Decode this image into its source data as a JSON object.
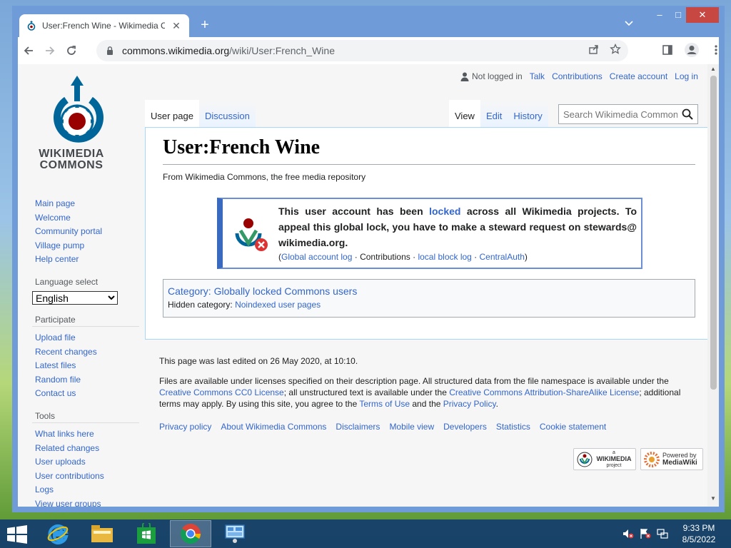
{
  "browser": {
    "tab_title": "User:French Wine - Wikimedia Commons",
    "tab_close": "✕",
    "new_tab": "+",
    "url_domain": "commons.wikimedia.org",
    "url_path": "/wiki/User:French_Wine",
    "window_controls": {
      "minimize": "–",
      "maximize": "□",
      "close": "✕"
    }
  },
  "personal": {
    "not_logged_in": "Not logged in",
    "links": [
      "Talk",
      "Contributions",
      "Create account",
      "Log in"
    ]
  },
  "logo": {
    "line1": "WIKIMEDIA",
    "line2": "COMMONS"
  },
  "sidebar": {
    "main": [
      "Main page",
      "Welcome",
      "Community portal",
      "Village pump",
      "Help center"
    ],
    "language_heading": "Language select",
    "language_value": "English",
    "participate_heading": "Participate",
    "participate": [
      "Upload file",
      "Recent changes",
      "Latest files",
      "Random file",
      "Contact us"
    ],
    "tools_heading": "Tools",
    "tools": [
      "What links here",
      "Related changes",
      "User uploads",
      "User contributions",
      "Logs",
      "View user groups"
    ]
  },
  "tabs": {
    "left": [
      "User page",
      "Discussion"
    ],
    "right": [
      "View",
      "Edit",
      "History"
    ]
  },
  "search": {
    "placeholder": "Search Wikimedia Commons"
  },
  "content": {
    "title": "User:French Wine",
    "site_sub": "From Wikimedia Commons, the free media repository",
    "lock_before": "This user account has been ",
    "lock_link": "locked",
    "lock_after": " across all Wikimedia projects. To appeal this global lock, you have to make a steward request on stewards@ wikimedia.org.",
    "lock_links": [
      "Global account log",
      "Contributions",
      "local block log",
      "CentralAuth"
    ],
    "category": "Category: Globally locked Commons users",
    "hidden_label": "Hidden category: ",
    "hidden_link": "Noindexed user pages"
  },
  "footer": {
    "last_edited": "This page was last edited on 26 May 2020, at 10:10.",
    "license_1": "Files are available under licenses specified on their description page. All structured data from the file namespace is available under the ",
    "license_link_1": "Creative Commons CC0 License",
    "license_2": "; all unstructured text is available under the ",
    "license_link_2": "Creative Commons Attribution-ShareAlike License",
    "license_3": "; additional terms may apply. By using this site, you agree to the ",
    "license_link_3": "Terms of Use",
    "license_4": " and the ",
    "license_link_4": "Privacy Policy",
    "license_5": ".",
    "links": [
      "Privacy policy",
      "About Wikimedia Commons",
      "Disclaimers",
      "Mobile view",
      "Developers",
      "Statistics",
      "Cookie statement"
    ],
    "badge_wikimedia_top": "a",
    "badge_wikimedia": "WIKIMEDIA",
    "badge_wikimedia_sub": "project",
    "badge_mediawiki_top": "Powered by",
    "badge_mediawiki": "MediaWiki"
  },
  "taskbar": {
    "time": "9:33 PM",
    "date": "8/5/2022"
  },
  "colors": {
    "link": "#3366cc",
    "lock_border": "#3a6abf",
    "taskbar": "#143c6e"
  }
}
